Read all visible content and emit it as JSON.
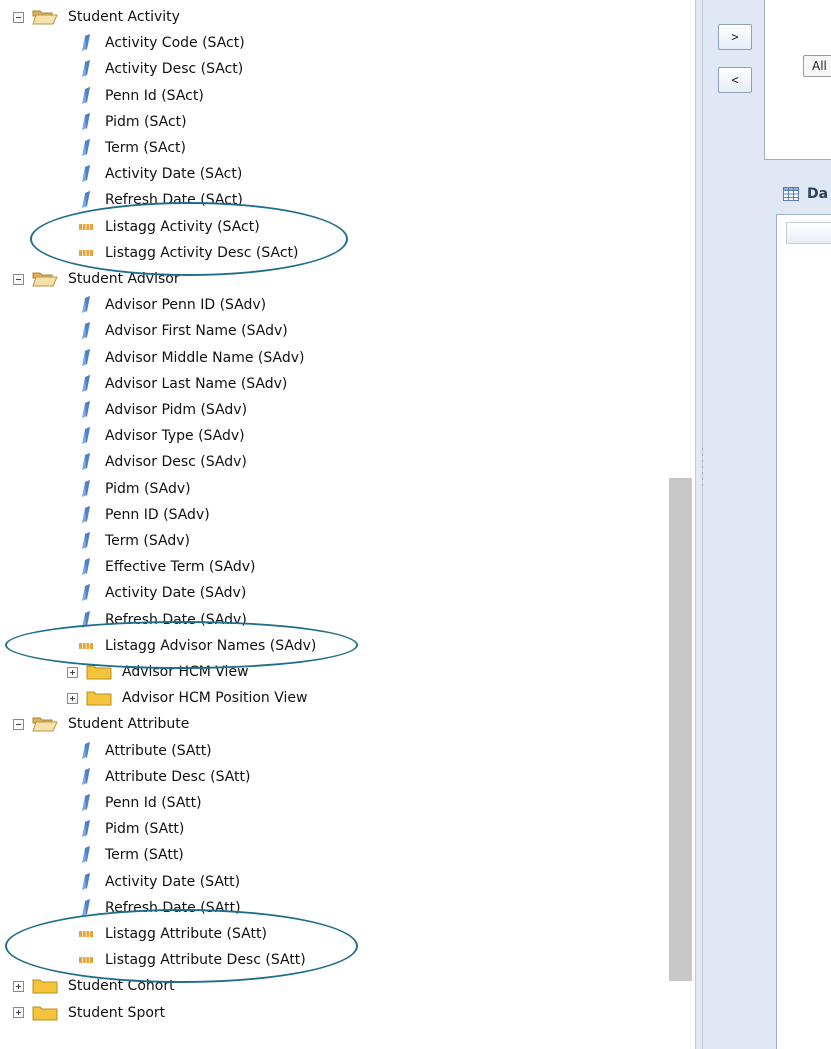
{
  "tree": {
    "folders": [
      {
        "label": "Student Activity",
        "expanded": true,
        "items": [
          {
            "label": "Activity Code (SAct)",
            "kind": "attribute"
          },
          {
            "label": "Activity Desc (SAct)",
            "kind": "attribute"
          },
          {
            "label": "Penn Id (SAct)",
            "kind": "attribute"
          },
          {
            "label": "Pidm (SAct)",
            "kind": "attribute"
          },
          {
            "label": "Term (SAct)",
            "kind": "attribute"
          },
          {
            "label": "Activity Date (SAct)",
            "kind": "attribute"
          },
          {
            "label": "Refresh Date (SAct)",
            "kind": "attribute"
          },
          {
            "label": "Listagg Activity (SAct)",
            "kind": "measure"
          },
          {
            "label": "Listagg Activity Desc (SAct)",
            "kind": "measure"
          }
        ]
      },
      {
        "label": "Student Advisor",
        "expanded": true,
        "items": [
          {
            "label": "Advisor Penn ID (SAdv)",
            "kind": "attribute"
          },
          {
            "label": "Advisor First Name (SAdv)",
            "kind": "attribute"
          },
          {
            "label": "Advisor Middle Name (SAdv)",
            "kind": "attribute"
          },
          {
            "label": "Advisor Last Name (SAdv)",
            "kind": "attribute"
          },
          {
            "label": "Advisor Pidm (SAdv)",
            "kind": "attribute"
          },
          {
            "label": "Advisor Type (SAdv)",
            "kind": "attribute"
          },
          {
            "label": "Advisor Desc (SAdv)",
            "kind": "attribute"
          },
          {
            "label": "Pidm (SAdv)",
            "kind": "attribute"
          },
          {
            "label": "Penn ID (SAdv)",
            "kind": "attribute"
          },
          {
            "label": "Term (SAdv)",
            "kind": "attribute"
          },
          {
            "label": "Effective Term (SAdv)",
            "kind": "attribute"
          },
          {
            "label": "Activity Date (SAdv)",
            "kind": "attribute"
          },
          {
            "label": "Refresh Date (SAdv)",
            "kind": "attribute"
          },
          {
            "label": "Listagg Advisor Names (SAdv)",
            "kind": "measure"
          },
          {
            "label": "Advisor HCM View",
            "kind": "subfolder"
          },
          {
            "label": "Advisor HCM Position View",
            "kind": "subfolder"
          }
        ]
      },
      {
        "label": "Student Attribute",
        "expanded": true,
        "items": [
          {
            "label": "Attribute (SAtt)",
            "kind": "attribute"
          },
          {
            "label": "Attribute Desc (SAtt)",
            "kind": "attribute"
          },
          {
            "label": "Penn Id (SAtt)",
            "kind": "attribute"
          },
          {
            "label": "Pidm (SAtt)",
            "kind": "attribute"
          },
          {
            "label": "Term (SAtt)",
            "kind": "attribute"
          },
          {
            "label": "Activity Date (SAtt)",
            "kind": "attribute"
          },
          {
            "label": "Refresh Date (SAtt)",
            "kind": "attribute"
          },
          {
            "label": "Listagg Attribute (SAtt)",
            "kind": "measure"
          },
          {
            "label": "Listagg Attribute Desc (SAtt)",
            "kind": "measure"
          }
        ]
      },
      {
        "label": "Student Cohort",
        "expanded": false,
        "items": []
      },
      {
        "label": "Student Sport",
        "expanded": false,
        "items": []
      }
    ]
  },
  "right_panel": {
    "move_right_label": ">",
    "move_left_label": "<",
    "all_button_label": "All",
    "data_section_title": "Da"
  },
  "colors": {
    "highlight_oval": "#1f6e8c",
    "attribute_icon": "#7aa9e6",
    "measure_icon": "#e8a23a",
    "folder_closed": "#f3c33c",
    "panel_bg": "#dfe8f4"
  }
}
